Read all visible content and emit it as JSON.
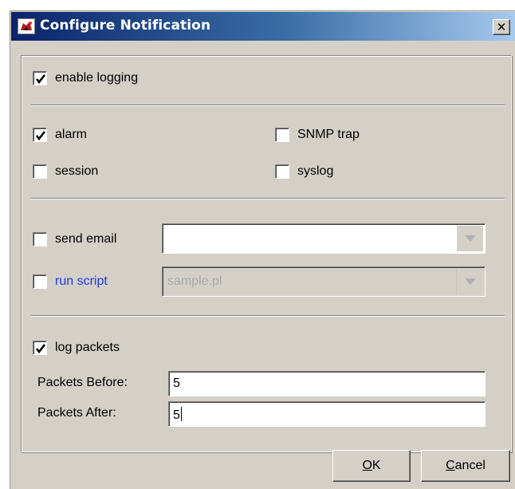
{
  "window": {
    "title": "Configure Notification",
    "close_glyph": "✕",
    "app_icon": "app-logo-icon"
  },
  "logging": {
    "enable_logging": {
      "label": "enable logging",
      "checked": true
    }
  },
  "destinations": {
    "alarm": {
      "label": "alarm",
      "checked": true
    },
    "snmp_trap": {
      "label": "SNMP trap",
      "checked": false
    },
    "session": {
      "label": "session",
      "checked": false
    },
    "syslog": {
      "label": "syslog",
      "checked": false
    }
  },
  "actions": {
    "send_email": {
      "label": "send email",
      "checked": false,
      "value": ""
    },
    "run_script": {
      "label": "run script",
      "checked": false,
      "value": "sample.pl",
      "label_color": "#1e3cde"
    }
  },
  "packets": {
    "log_packets": {
      "label": "log packets",
      "checked": true
    },
    "before_label": "Packets Before:",
    "before_value": "5",
    "after_label": "Packets After:",
    "after_value": "5"
  },
  "buttons": {
    "ok_mnemonic": "O",
    "ok_rest": "K",
    "cancel_mnemonic": "C",
    "cancel_rest": "ancel"
  },
  "colors": {
    "titlebar_start": "#0a246a",
    "titlebar_end": "#a6caf0",
    "dialog_bg": "#d4d0c8"
  }
}
